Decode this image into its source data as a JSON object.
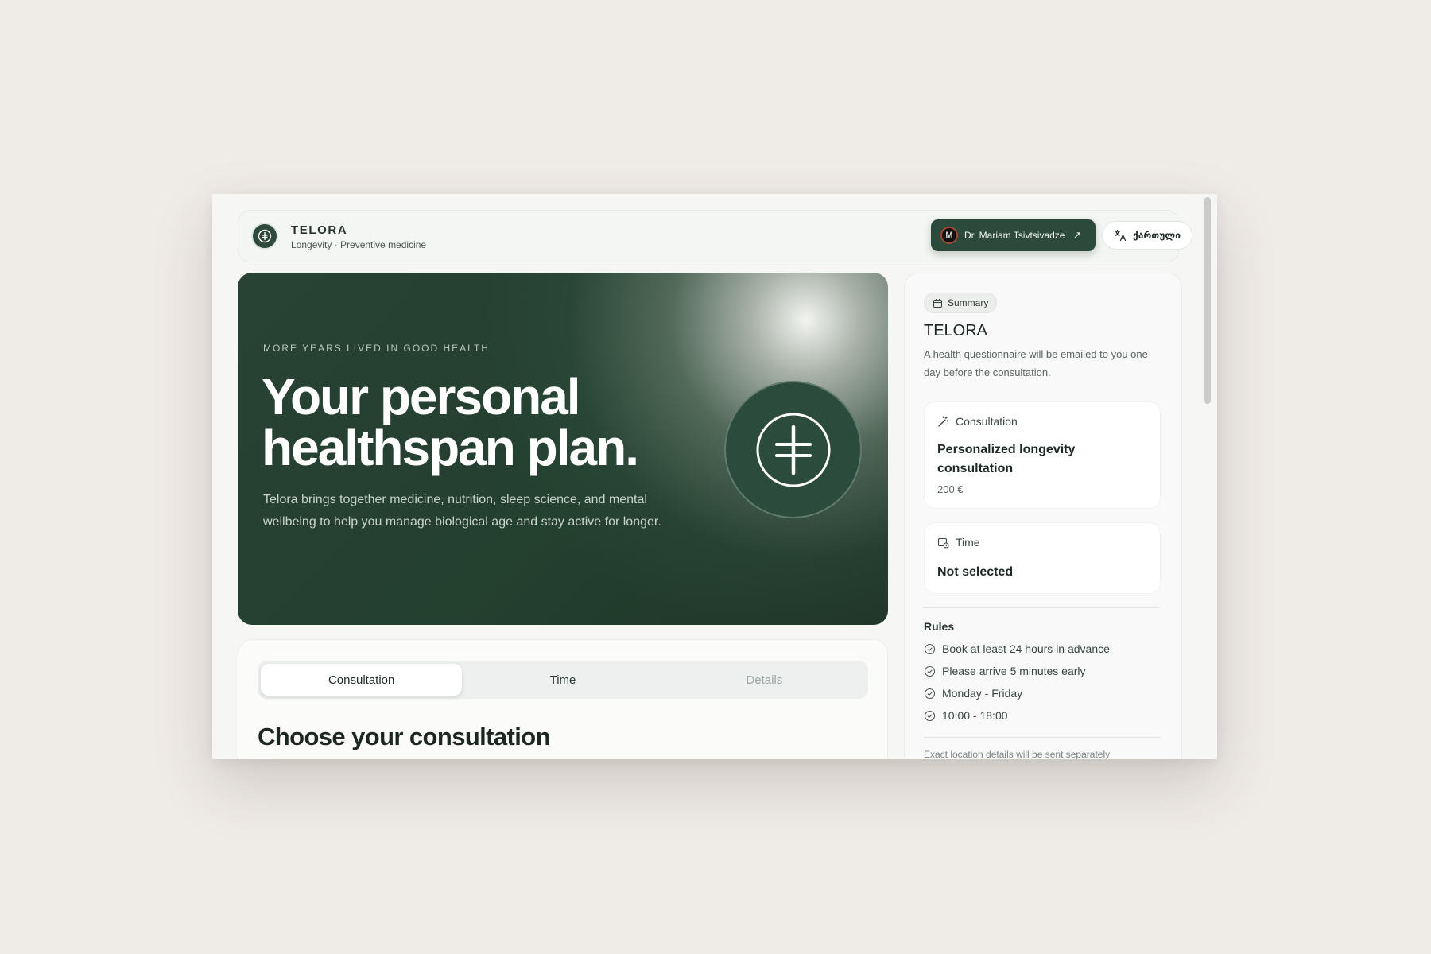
{
  "brand": {
    "name": "TELORA",
    "subtitle": "Longevity · Preventive medicine"
  },
  "header": {
    "doctor_label": "Dr. Mariam Tsivtsivadze",
    "language_label": "ქართული"
  },
  "hero": {
    "eyebrow": "MORE YEARS LIVED IN GOOD HEALTH",
    "title_line1": "Your personal",
    "title_line2": "healthspan plan.",
    "description": "Telora brings together medicine, nutrition, sleep science, and mental wellbeing to help you manage biological age and stay active for longer."
  },
  "booking": {
    "tabs": [
      {
        "label": "Consultation",
        "state": "active"
      },
      {
        "label": "Time",
        "state": "default"
      },
      {
        "label": "Details",
        "state": "disabled"
      }
    ],
    "title": "Choose your consultation"
  },
  "summary": {
    "chip": "Summary",
    "title": "TELORA",
    "description": "A health questionnaire will be emailed to you one day before the consultation.",
    "consultation": {
      "label": "Consultation",
      "value": "Personalized longevity consultation",
      "price": "200 €"
    },
    "time": {
      "label": "Time",
      "value": "Not selected"
    },
    "rules_title": "Rules",
    "rules": [
      "Book at least 24 hours in advance",
      "Please arrive 5 minutes early",
      "Monday - Friday",
      "10:00 - 18:00"
    ],
    "footnote": "Exact location details will be sent separately"
  },
  "colors": {
    "brand_green": "#2c4a3b",
    "hero_dark": "#24402f",
    "page_bg": "#efebe7"
  }
}
